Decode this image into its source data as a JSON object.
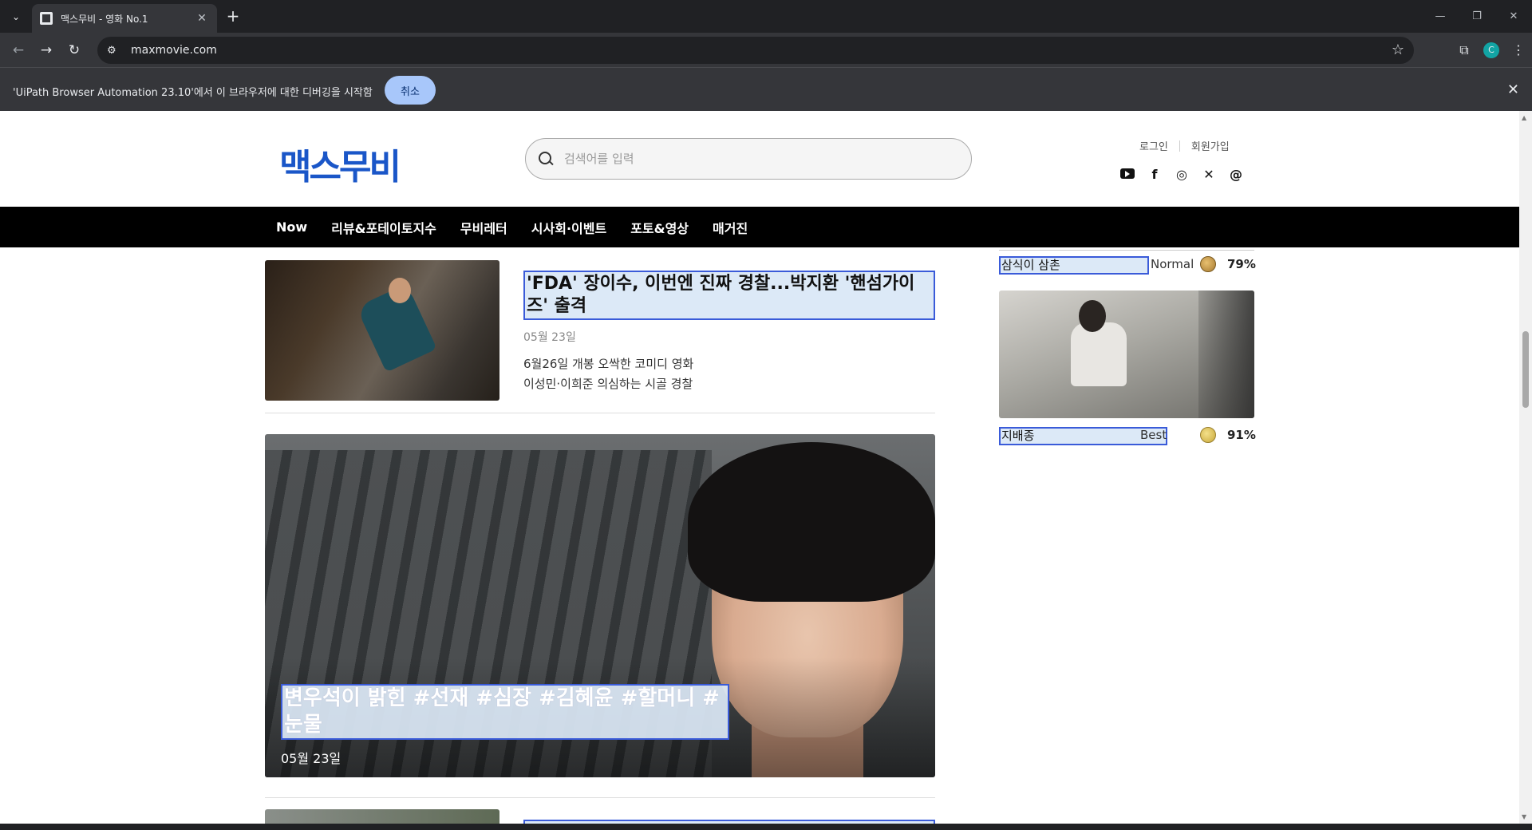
{
  "browser": {
    "tab_title": "맥스무비 - 영화 No.1",
    "url": "maxmovie.com",
    "infobar_text": "'UiPath Browser Automation 23.10'에서 이 브라우저에 대한 디버깅을 시작함",
    "infobar_button": "취소",
    "profile_initial": "C"
  },
  "header": {
    "logo": "맥스무비",
    "search_placeholder": "검색어를 입력",
    "login": "로그인",
    "signup": "회원가입"
  },
  "nav": [
    "Now",
    "리뷰&포테이토지수",
    "무비레터",
    "시사회·이벤트",
    "포토&영상",
    "매거진"
  ],
  "articles": [
    {
      "title": "'FDA' 장이수, 이번엔 진짜 경찰...박지환 '핸섬가이즈' 출격",
      "date": "05월 23일",
      "line1": "6월26일 개봉 오싹한 코미디 영화",
      "line2": "이성민·이희준 의심하는 시골 경찰"
    }
  ],
  "feature": {
    "title": "변우석이 밝힌 #선재 #심장 #김혜윤 #할머니 #눈물",
    "date": "05월 23일"
  },
  "sidebar": [
    {
      "title": "삼식이 삼촌",
      "grade": "Normal",
      "percent": "79%"
    },
    {
      "title": "지배종",
      "grade": "Best",
      "percent": "91%"
    }
  ]
}
